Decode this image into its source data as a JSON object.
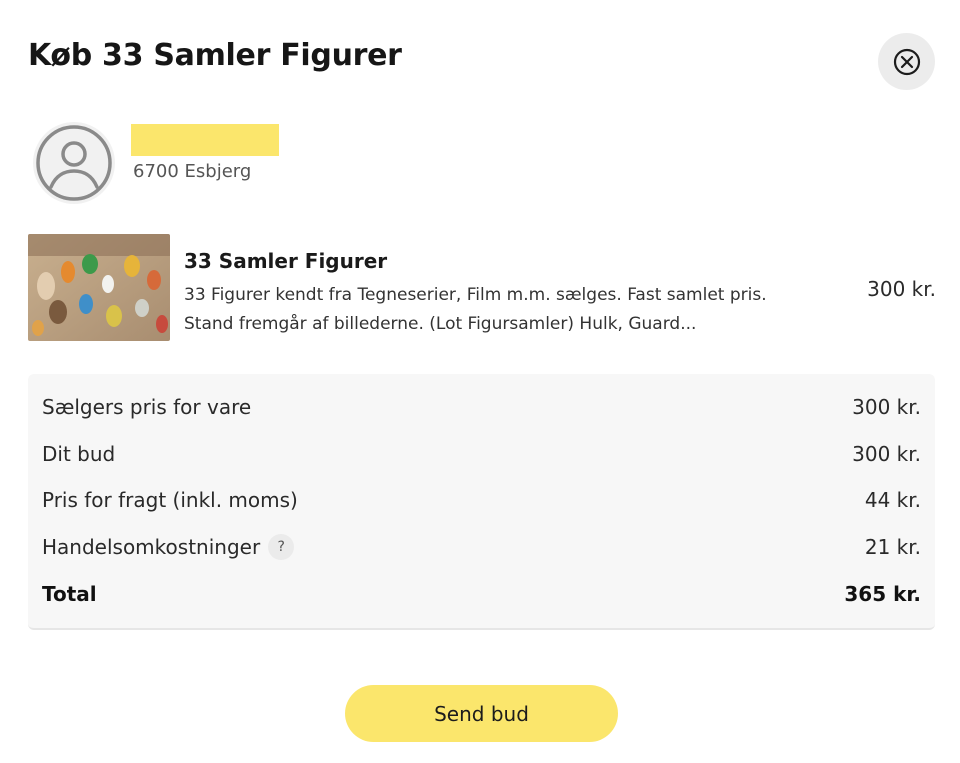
{
  "dialog": {
    "title": "Køb 33 Samler Figurer",
    "close_icon": "close-circle-icon"
  },
  "seller": {
    "avatar_icon": "user-avatar-icon",
    "name_redacted": true,
    "location": "6700 Esbjerg"
  },
  "item": {
    "title": "33 Samler Figurer",
    "description": "33 Figurer kendt fra Tegneserier, Film m.m. sælges. Fast samlet pris. Stand fremgår af billederne. (Lot Figursamler) Hulk, Guard...",
    "price": "300 kr."
  },
  "summary": {
    "rows": [
      {
        "label": "Sælgers pris for vare",
        "value": "300 kr."
      },
      {
        "label": "Dit bud",
        "value": "300 kr."
      },
      {
        "label": "Pris for fragt (inkl. moms)",
        "value": "44 kr."
      },
      {
        "label": "Handelsomkostninger",
        "value": "21 kr.",
        "help": "?"
      }
    ],
    "total": {
      "label": "Total",
      "value": "365 kr."
    }
  },
  "actions": {
    "send_label": "Send bud"
  },
  "colors": {
    "accent": "#fbe66c",
    "summary_bg": "#f7f7f7",
    "close_bg": "#ececec"
  }
}
